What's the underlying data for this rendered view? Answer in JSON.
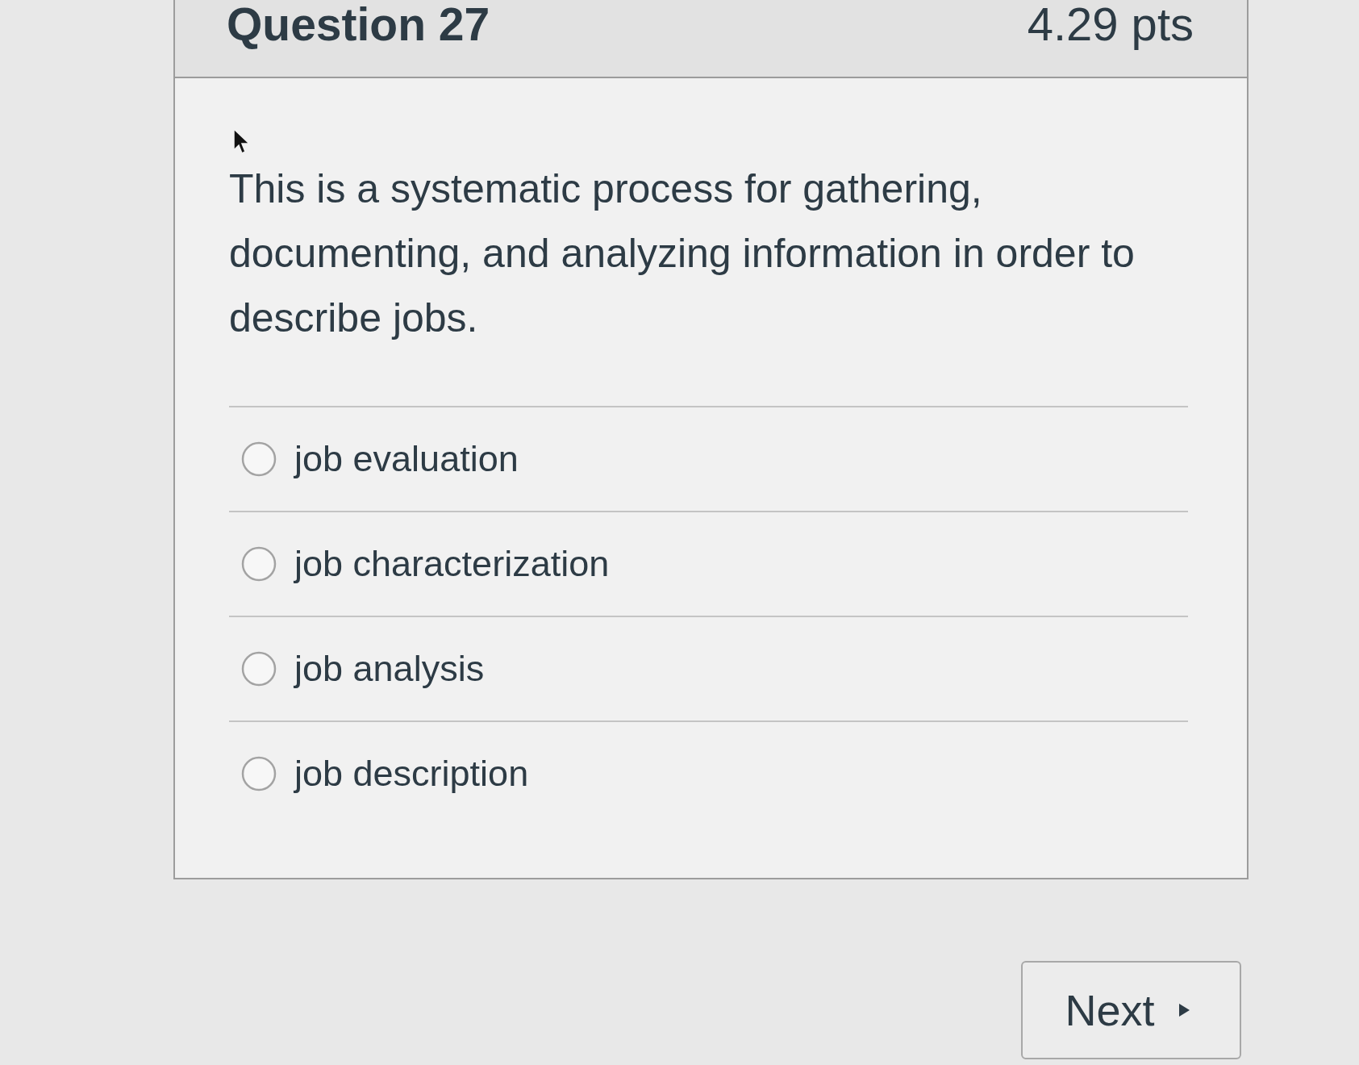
{
  "question": {
    "title": "Question 27",
    "points": "4.29 pts",
    "text": "This is a systematic process for gathering, documenting, and analyzing information in order to describe jobs."
  },
  "answers": [
    {
      "label": "job evaluation",
      "selected": false
    },
    {
      "label": "job characterization",
      "selected": false
    },
    {
      "label": "job analysis",
      "selected": false
    },
    {
      "label": "job description",
      "selected": false
    }
  ],
  "next_button": {
    "label": "Next"
  }
}
